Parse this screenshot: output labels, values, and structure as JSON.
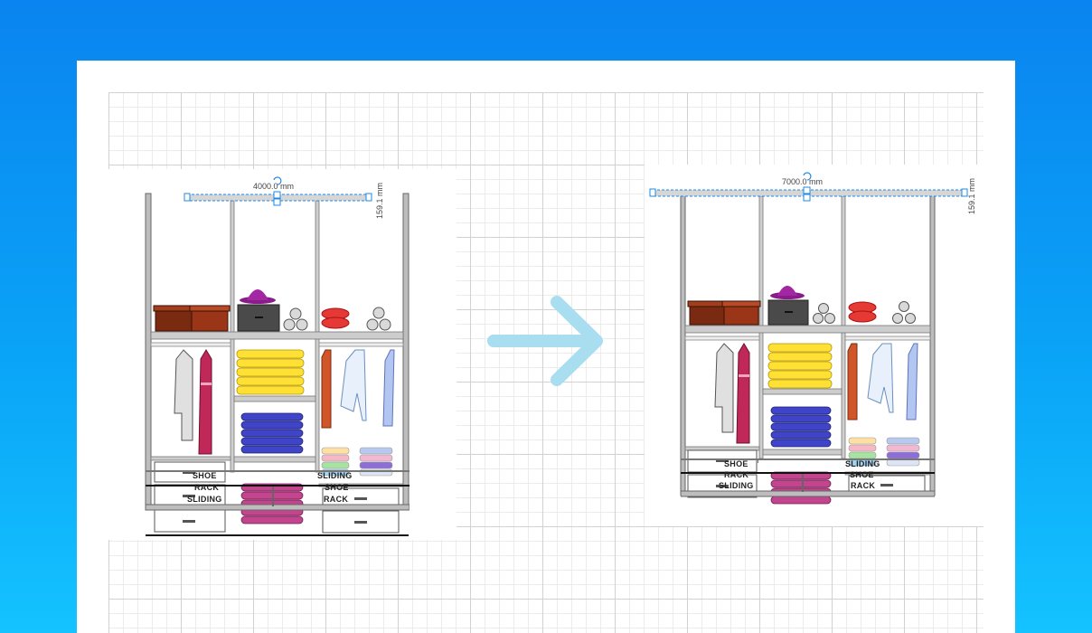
{
  "colors": {
    "background_top": "#0a84f0",
    "background_bottom": "#14c3ff",
    "arrow": "#a9ddf0",
    "selection": "#1e88e5",
    "frame": "#9e9e9e"
  },
  "before": {
    "width_label": "4000.0 mm",
    "height_label": "159.1 mm",
    "shoe_rack_label": [
      "SHOE",
      "RACK",
      "SLIDING"
    ],
    "sliding_shoe_label": [
      "SLIDING",
      "SHOE",
      "RACK"
    ]
  },
  "after": {
    "width_label": "7000.0 mm",
    "height_label": "159.1 mm",
    "shoe_rack_label": [
      "SHOE",
      "RACK",
      "SLIDING"
    ],
    "sliding_shoe_label": [
      "SLIDING",
      "SHOE",
      "RACK"
    ]
  },
  "icons": {
    "transition": "right-arrow-icon",
    "rotate": "rotate-handle-icon"
  }
}
